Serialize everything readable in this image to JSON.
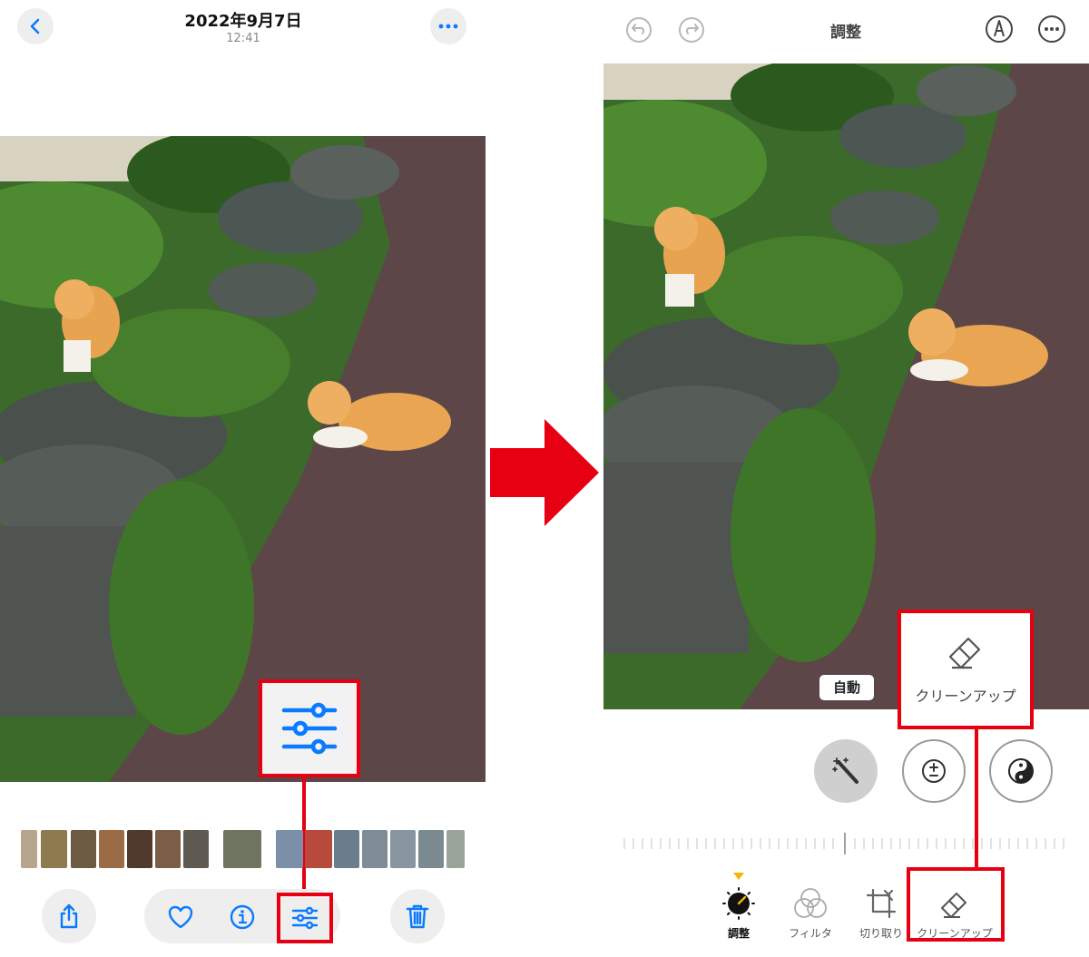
{
  "left": {
    "header": {
      "date": "2022年9月7日",
      "time": "12:41"
    },
    "thumbnails": [
      "#b7a58e",
      "#8d7a4e",
      "#6b5b42",
      "#9a6b45",
      "#4f3a2c",
      "#7b5e45",
      "#5e5a52",
      "#6f7561",
      "#7c8fa8",
      "#b74a3a",
      "#6b7d8c",
      "#7f8b96",
      "#8996a1",
      "#7a8a90",
      "#9aa49a",
      "#c8c2b0"
    ],
    "toolbar": [
      "share-icon",
      "heart-icon",
      "info-icon",
      "adjust-icon",
      "trash-icon"
    ]
  },
  "right": {
    "header": {
      "title": "調整"
    },
    "auto_badge": "自動",
    "cleanup_popup_label": "クリーンアップ",
    "tabs": [
      {
        "label": "調整"
      },
      {
        "label": "フィルタ"
      },
      {
        "label": "切り取り"
      },
      {
        "label": "クリーンアップ"
      }
    ]
  },
  "colors": {
    "accent": "#0a7aff",
    "highlight": "#e60012",
    "tab_indicator": "#f2b705"
  }
}
